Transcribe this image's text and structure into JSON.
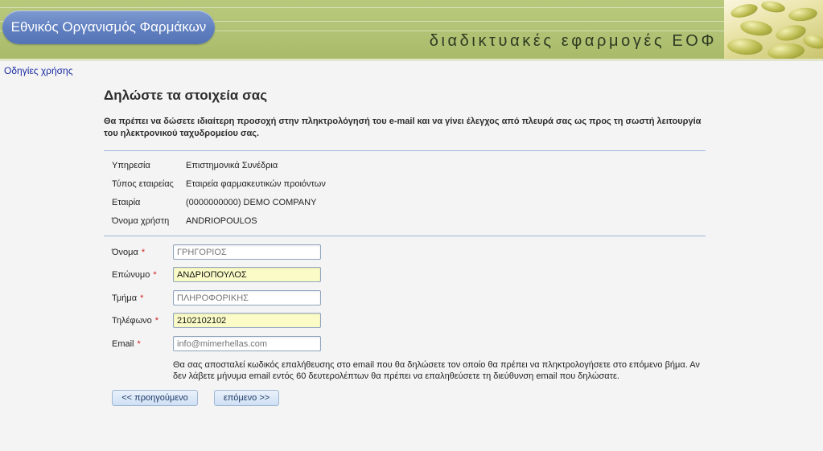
{
  "header": {
    "logo_text": "Εθνικός Οργανισμός Φαρμάκων",
    "app_title": "διαδικτυακές εφαρμογές ΕΟΦ",
    "banner_color": "#b3c477",
    "logo_color": "#5f7fc0"
  },
  "help_link": "Οδηγίες χρήσης",
  "page_title": "Δηλώστε τα στοιχεία σας",
  "intro_text": "Θα πρέπει να δώσετε ιδιαίτερη προσοχή στην πληκτρολόγησή του e-mail και να γίνει έλεγχος από πλευρά σας ως προς τη σωστή λειτουργία του ηλεκτρονικού ταχυδρομείου σας.",
  "info": [
    {
      "label": "Υπηρεσία",
      "value": "Επιστημονικά Συνέδρια"
    },
    {
      "label": "Τύπος εταιρείας",
      "value": "Εταιρεία φαρμακευτικών προιόντων"
    },
    {
      "label": "Εταιρία",
      "value": "(0000000000) DEMO COMPANY"
    },
    {
      "label": "Όνομα χρήστη",
      "value": "ANDRIOPOULOS"
    }
  ],
  "form": {
    "required_mark": "*",
    "fields": [
      {
        "label": "Όνομα",
        "value": "",
        "placeholder": "ΓΡΗΓΟΡΙΟΣ"
      },
      {
        "label": "Επώνυμο",
        "value": "ΑΝΔΡΙΟΠΟΥΛΟΣ",
        "placeholder": ""
      },
      {
        "label": "Τμήμα",
        "value": "",
        "placeholder": "ΠΛΗΡΟΦΟΡΙΚΗΣ"
      },
      {
        "label": "Τηλέφωνο",
        "value": "2102102102",
        "placeholder": ""
      },
      {
        "label": "Email",
        "value": "",
        "placeholder": "info@mimerhellas.com"
      }
    ]
  },
  "note": "Θα σας αποσταλεί κωδικός επαλήθευσης στο email που θα δηλώσετε τον οποίο θα πρέπει να πληκτρολογήσετε στο επόμενο βήμα. Αν δεν λάβετε μήνυμα email εντός 60 δευτερολέπτων θα πρέπει να επαληθεύσετε τη διεύθυνση email που δηλώσατε.",
  "buttons": {
    "previous": "<< προηγούμενο",
    "next": "επόμενο >>"
  },
  "colors": {
    "field_highlight": "#fbfbc8",
    "required": "#d02020",
    "rule": "#9ab8d8"
  }
}
